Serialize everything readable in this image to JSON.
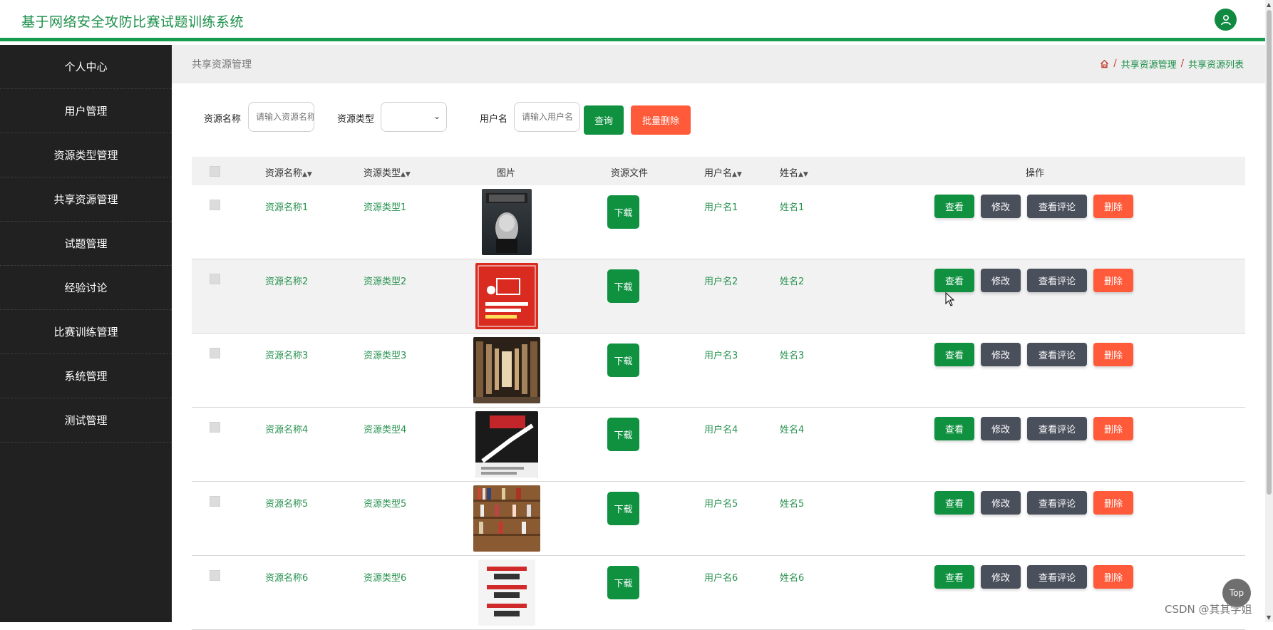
{
  "header": {
    "title": "基于网络安全攻防比赛试题训练系统",
    "avatar_icon": "user-icon"
  },
  "sidebar": {
    "items": [
      {
        "label": "个人中心"
      },
      {
        "label": "用户管理"
      },
      {
        "label": "资源类型管理"
      },
      {
        "label": "共享资源管理"
      },
      {
        "label": "试题管理"
      },
      {
        "label": "经验讨论"
      },
      {
        "label": "比赛训练管理"
      },
      {
        "label": "系统管理"
      },
      {
        "label": "测试管理"
      }
    ]
  },
  "breadcrumb": {
    "page_title": "共享资源管理",
    "home_icon": "home-icon",
    "sep": "/",
    "crumb1": "共享资源管理",
    "crumb2": "共享资源列表"
  },
  "search": {
    "name_label": "资源名称",
    "name_placeholder": "请输入资源名称",
    "type_label": "资源类型",
    "type_value": "",
    "user_label": "用户名",
    "user_placeholder": "请输入用户名",
    "query_btn": "查询",
    "batch_delete_btn": "批量删除"
  },
  "table": {
    "headers": {
      "name": "资源名称",
      "type": "资源类型",
      "image": "图片",
      "file": "资源文件",
      "user": "用户名",
      "realname": "姓名",
      "ops": "操作"
    },
    "rows": [
      {
        "name": "资源名称1",
        "type": "资源类型1",
        "user": "用户名1",
        "realname": "姓名1"
      },
      {
        "name": "资源名称2",
        "type": "资源类型2",
        "user": "用户名2",
        "realname": "姓名2"
      },
      {
        "name": "资源名称3",
        "type": "资源类型3",
        "user": "用户名3",
        "realname": "姓名3"
      },
      {
        "name": "资源名称4",
        "type": "资源类型4",
        "user": "用户名4",
        "realname": "姓名4"
      },
      {
        "name": "资源名称5",
        "type": "资源类型5",
        "user": "用户名5",
        "realname": "姓名5"
      },
      {
        "name": "资源名称6",
        "type": "资源类型6",
        "user": "用户名6",
        "realname": "姓名6"
      }
    ],
    "download_label": "下载",
    "view_label": "查看",
    "edit_label": "修改",
    "comments_label": "查看评论",
    "delete_label": "删除"
  },
  "top_button": "Top",
  "watermark": "CSDN @其其学姐",
  "colors": {
    "accent": "#0f9140",
    "danger": "#ff5a3a",
    "sidebar": "#212121",
    "neutral_btn": "#4a4f5c"
  }
}
